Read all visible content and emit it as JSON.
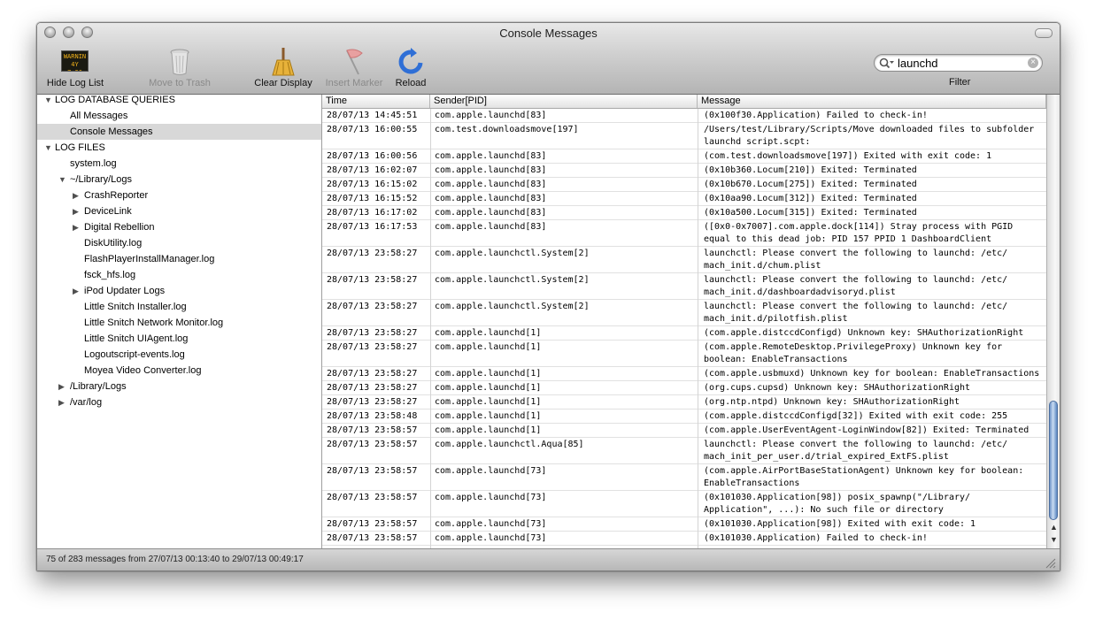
{
  "window": {
    "title": "Console Messages"
  },
  "toolbar": {
    "hide_log_list": "Hide Log List",
    "warning_icon_text": [
      "WARNIN",
      "4Y 7:36"
    ],
    "move_to_trash": "Move to Trash",
    "clear_display": "Clear Display",
    "insert_marker": "Insert Marker",
    "reload": "Reload",
    "filter_label": "Filter",
    "search_value": "launchd"
  },
  "sidebar": {
    "items": [
      {
        "label": "LOG DATABASE QUERIES",
        "level": 0,
        "disclosure": "open"
      },
      {
        "label": "All Messages",
        "level": 1,
        "disclosure": "none"
      },
      {
        "label": "Console Messages",
        "level": 1,
        "disclosure": "none",
        "selected": true
      },
      {
        "label": "LOG FILES",
        "level": 0,
        "disclosure": "open"
      },
      {
        "label": "system.log",
        "level": 1,
        "disclosure": "none"
      },
      {
        "label": "~/Library/Logs",
        "level": 1,
        "disclosure": "open"
      },
      {
        "label": "CrashReporter",
        "level": 2,
        "disclosure": "closed"
      },
      {
        "label": "DeviceLink",
        "level": 2,
        "disclosure": "closed"
      },
      {
        "label": "Digital Rebellion",
        "level": 2,
        "disclosure": "closed"
      },
      {
        "label": "DiskUtility.log",
        "level": 2,
        "disclosure": "none"
      },
      {
        "label": "FlashPlayerInstallManager.log",
        "level": 2,
        "disclosure": "none"
      },
      {
        "label": "fsck_hfs.log",
        "level": 2,
        "disclosure": "none"
      },
      {
        "label": "iPod Updater Logs",
        "level": 2,
        "disclosure": "closed"
      },
      {
        "label": "Little Snitch Installer.log",
        "level": 2,
        "disclosure": "none"
      },
      {
        "label": "Little Snitch Network Monitor.log",
        "level": 2,
        "disclosure": "none"
      },
      {
        "label": "Little Snitch UIAgent.log",
        "level": 2,
        "disclosure": "none"
      },
      {
        "label": "Logoutscript-events.log",
        "level": 2,
        "disclosure": "none"
      },
      {
        "label": "Moyea Video Converter.log",
        "level": 2,
        "disclosure": "none"
      },
      {
        "label": "/Library/Logs",
        "level": 1,
        "disclosure": "closed"
      },
      {
        "label": "/var/log",
        "level": 1,
        "disclosure": "closed"
      }
    ]
  },
  "table": {
    "columns": [
      "Time",
      "Sender[PID]",
      "Message"
    ],
    "rows": [
      {
        "time": "28/07/13 14:45:51",
        "sender": "com.apple.launchd[83]",
        "message": "(0x100f30.Application) Failed to check-in!"
      },
      {
        "time": "28/07/13 16:00:55",
        "sender": "com.test.downloadsmove[197]",
        "message": "/Users/test/Library/Scripts/Move downloaded files to subfolder\nlaunchd script.scpt:"
      },
      {
        "time": "28/07/13 16:00:56",
        "sender": "com.apple.launchd[83]",
        "message": "(com.test.downloadsmove[197]) Exited with exit code: 1"
      },
      {
        "time": "28/07/13 16:02:07",
        "sender": "com.apple.launchd[83]",
        "message": "(0x10b360.Locum[210]) Exited: Terminated"
      },
      {
        "time": "28/07/13 16:15:02",
        "sender": "com.apple.launchd[83]",
        "message": "(0x10b670.Locum[275]) Exited: Terminated"
      },
      {
        "time": "28/07/13 16:15:52",
        "sender": "com.apple.launchd[83]",
        "message": "(0x10aa90.Locum[312]) Exited: Terminated"
      },
      {
        "time": "28/07/13 16:17:02",
        "sender": "com.apple.launchd[83]",
        "message": "(0x10a500.Locum[315]) Exited: Terminated"
      },
      {
        "time": "28/07/13 16:17:53",
        "sender": "com.apple.launchd[83]",
        "message": "([0x0-0x7007].com.apple.dock[114]) Stray process with PGID\nequal to this dead job: PID 157 PPID 1 DashboardClient"
      },
      {
        "time": "28/07/13 23:58:27",
        "sender": "com.apple.launchctl.System[2]",
        "message": "launchctl: Please convert the following to launchd: /etc/\nmach_init.d/chum.plist"
      },
      {
        "time": "28/07/13 23:58:27",
        "sender": "com.apple.launchctl.System[2]",
        "message": "launchctl: Please convert the following to launchd: /etc/\nmach_init.d/dashboardadvisoryd.plist"
      },
      {
        "time": "28/07/13 23:58:27",
        "sender": "com.apple.launchctl.System[2]",
        "message": "launchctl: Please convert the following to launchd: /etc/\nmach_init.d/pilotfish.plist"
      },
      {
        "time": "28/07/13 23:58:27",
        "sender": "com.apple.launchd[1]",
        "message": "(com.apple.distccdConfigd) Unknown key: SHAuthorizationRight"
      },
      {
        "time": "28/07/13 23:58:27",
        "sender": "com.apple.launchd[1]",
        "message": "(com.apple.RemoteDesktop.PrivilegeProxy) Unknown key for\nboolean: EnableTransactions"
      },
      {
        "time": "28/07/13 23:58:27",
        "sender": "com.apple.launchd[1]",
        "message": "(com.apple.usbmuxd) Unknown key for boolean: EnableTransactions"
      },
      {
        "time": "28/07/13 23:58:27",
        "sender": "com.apple.launchd[1]",
        "message": "(org.cups.cupsd) Unknown key: SHAuthorizationRight"
      },
      {
        "time": "28/07/13 23:58:27",
        "sender": "com.apple.launchd[1]",
        "message": "(org.ntp.ntpd) Unknown key: SHAuthorizationRight"
      },
      {
        "time": "28/07/13 23:58:48",
        "sender": "com.apple.launchd[1]",
        "message": "(com.apple.distccdConfigd[32]) Exited with exit code: 255"
      },
      {
        "time": "28/07/13 23:58:57",
        "sender": "com.apple.launchd[1]",
        "message": "(com.apple.UserEventAgent-LoginWindow[82]) Exited: Terminated"
      },
      {
        "time": "28/07/13 23:58:57",
        "sender": "com.apple.launchctl.Aqua[85]",
        "message": "launchctl: Please convert the following to launchd: /etc/\nmach_init_per_user.d/trial_expired_ExtFS.plist"
      },
      {
        "time": "28/07/13 23:58:57",
        "sender": "com.apple.launchd[73]",
        "message": "(com.apple.AirPortBaseStationAgent) Unknown key for boolean:\nEnableTransactions"
      },
      {
        "time": "28/07/13 23:58:57",
        "sender": "com.apple.launchd[73]",
        "message": "(0x101030.Application[98]) posix_spawnp(\"/Library/\nApplication\", ...): No such file or directory"
      },
      {
        "time": "28/07/13 23:58:57",
        "sender": "com.apple.launchd[73]",
        "message": "(0x101030.Application[98]) Exited with exit code: 1"
      },
      {
        "time": "28/07/13 23:58:57",
        "sender": "com.apple.launchd[73]",
        "message": "(0x101030.Application) Failed to check-in!"
      }
    ]
  },
  "status": {
    "text": "75 of 283 messages from 27/07/13 00:13:40 to 29/07/13 00:49:17"
  }
}
